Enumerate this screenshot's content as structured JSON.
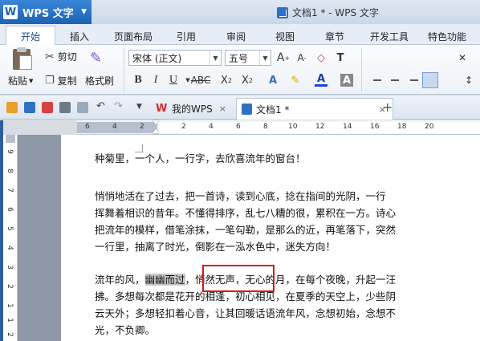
{
  "app": {
    "logo": "W",
    "name": "WPS 文字",
    "caret": "▼"
  },
  "window": {
    "title": "文档1 * - WPS 文字"
  },
  "menu": {
    "tabs": [
      {
        "label": "开始",
        "active": true
      },
      {
        "label": "插入"
      },
      {
        "label": "页面布局"
      },
      {
        "label": "引用"
      },
      {
        "label": "审阅"
      },
      {
        "label": "视图"
      },
      {
        "label": "章节"
      },
      {
        "label": "开发工具"
      },
      {
        "label": "特色功能"
      }
    ]
  },
  "ribbon": {
    "cut": "剪切",
    "paste": "粘贴",
    "copy": "复制",
    "format_painter": "格式刷",
    "font_name": "宋体 (正文)",
    "font_size": "五号",
    "paste_caret": "▼"
  },
  "tabs": {
    "mywps": "我的WPS",
    "doc": "文档1 *",
    "close": "×",
    "new": "+"
  },
  "ruler": {
    "h_labels": [
      "6",
      "4",
      "2",
      "2",
      "4",
      "6",
      "8",
      "10",
      "12",
      "14",
      "16",
      "18",
      "20"
    ],
    "v_labels": [
      "9",
      "8",
      "7",
      "6",
      "5",
      "4",
      "3",
      "2",
      "1",
      "1",
      "2"
    ]
  },
  "document": {
    "lines": [
      "种菊里，一个人，一行字，去欣喜流年的窗台！",
      "",
      "悄悄地活在了过去，把一首诗，读到心底，捻在指间的光阴，一行",
      "挥舞着相识的昔年。不懂得排序，乱七八糟的很，累积在一方。诗心",
      "把流年的模样，借笔涂抹，一笔勾勒，是那么的近，再笔落下，突然",
      "一行里，抽离了时光，倒影在一泓水色中，迷失方向！",
      "",
      "流年的风，幽幽而过，悄然无声，无心的月，在每个夜晚，升起一汪",
      "拂。多想每次都是花开的相逢，初心相见，在夏季的天空上，少些阴",
      "云天外；多想轻扣着心音，让其回暖话语流年风，念想初始，念想不",
      "光，不负卿。"
    ],
    "highlight": {
      "before": "流年的风，",
      "selected": "幽幽而过",
      "after": "，悄然无声，无心的月，在每个夜晚，升起一汪"
    }
  }
}
